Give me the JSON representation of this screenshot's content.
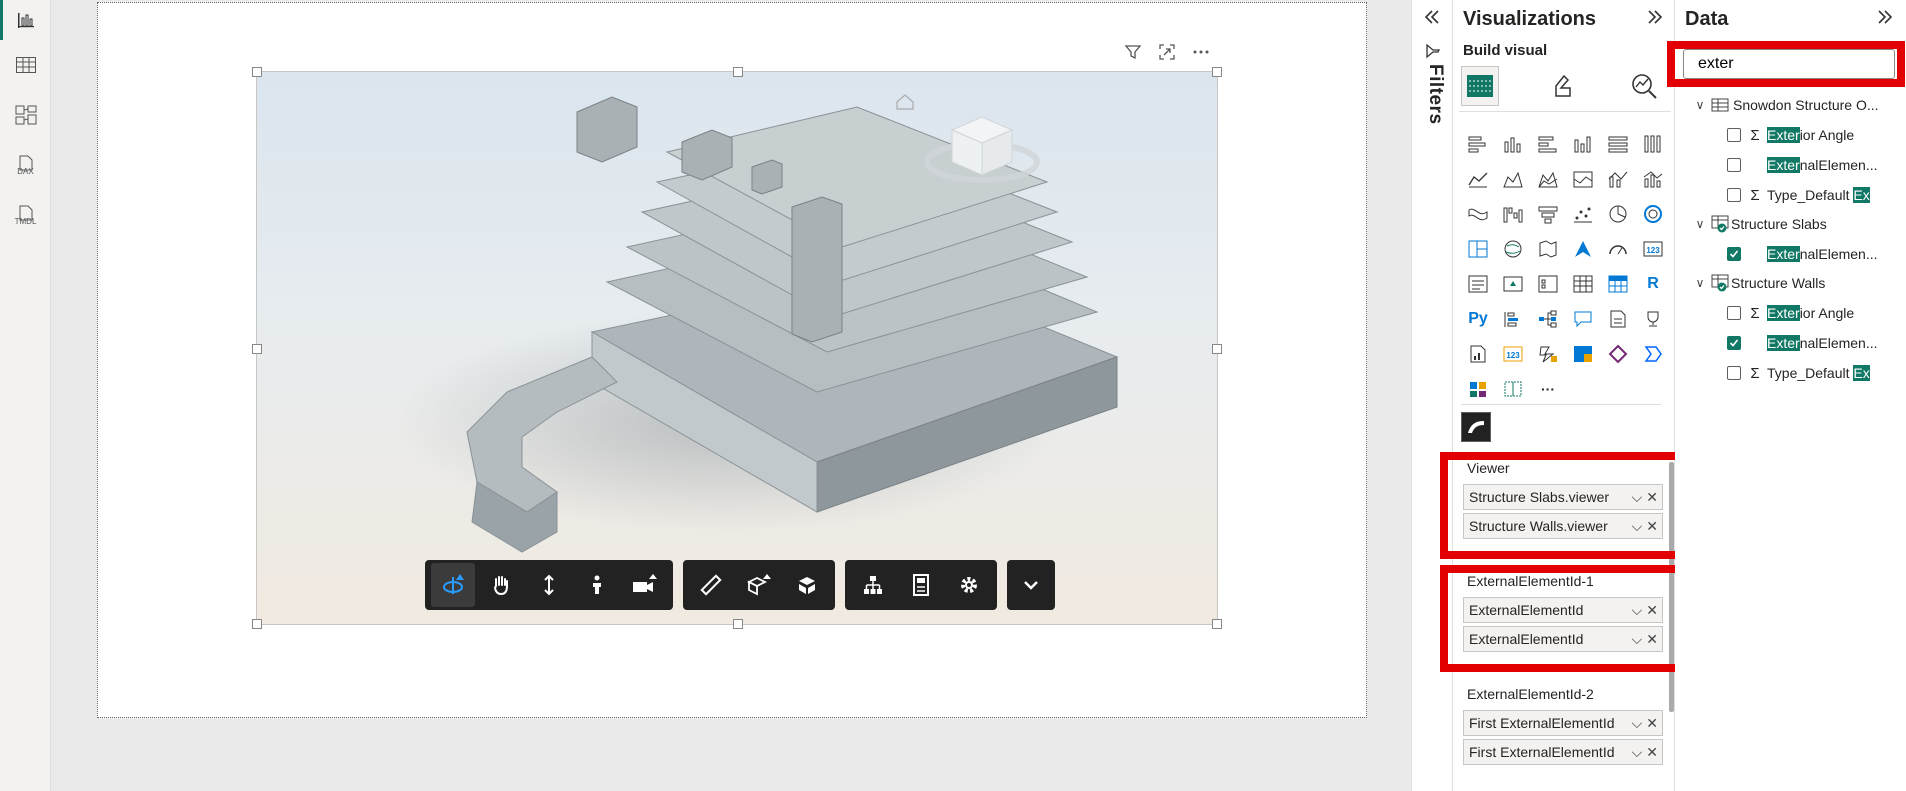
{
  "left_rail": {
    "items": [
      {
        "name": "report-view",
        "label": ""
      },
      {
        "name": "table-view",
        "label": ""
      },
      {
        "name": "model-view",
        "label": ""
      },
      {
        "name": "dax-query-view",
        "label": "DAX"
      },
      {
        "name": "tmdl-view",
        "label": "TMDL"
      }
    ]
  },
  "visual": {
    "toolbar_groups": [
      [
        "orbit-icon",
        "pan-icon",
        "zoom-icon",
        "first-person-icon",
        "camera-icon"
      ],
      [
        "measure-icon",
        "section-icon",
        "explode-icon"
      ],
      [
        "model-browser-icon",
        "properties-icon",
        "settings-icon"
      ],
      [
        "chevron-down-icon"
      ]
    ]
  },
  "filters": {
    "label": "Filters"
  },
  "visualizations": {
    "title": "Visualizations",
    "build_visual": "Build visual",
    "python_label": "Py",
    "r_label": "R",
    "card_label": "123",
    "more_label": "···",
    "wells": [
      {
        "label": "Viewer",
        "fields": [
          "Structure Slabs.viewer",
          "Structure Walls.viewer"
        ]
      },
      {
        "label": "ExternalElementId-1",
        "fields": [
          "ExternalElementId",
          "ExternalElementId"
        ]
      },
      {
        "label": "ExternalElementId-2",
        "fields": [
          "First ExternalElementId",
          "First ExternalElementId"
        ]
      }
    ]
  },
  "data": {
    "title": "Data",
    "search_value": "exter",
    "tables": [
      {
        "name": "Snowdon Structure O...",
        "fields": [
          {
            "pre": "",
            "hl": "Exter",
            "post": "ior Angle",
            "sigma": true,
            "checked": false
          },
          {
            "pre": "",
            "hl": "Exter",
            "post": "nalElemen...",
            "sigma": false,
            "checked": false
          },
          {
            "pre": "Type_Default ",
            "hl": "Ex",
            "post": "",
            "sigma": true,
            "checked": false
          }
        ]
      },
      {
        "name": "Structure Slabs",
        "fields": [
          {
            "pre": "",
            "hl": "Exter",
            "post": "nalElemen...",
            "sigma": false,
            "checked": true
          }
        ]
      },
      {
        "name": "Structure Walls",
        "fields": [
          {
            "pre": "",
            "hl": "Exter",
            "post": "ior Angle",
            "sigma": true,
            "checked": false
          },
          {
            "pre": "",
            "hl": "Exter",
            "post": "nalElemen...",
            "sigma": false,
            "checked": true
          },
          {
            "pre": "Type_Default ",
            "hl": "Ex",
            "post": "",
            "sigma": true,
            "checked": false
          }
        ]
      }
    ]
  },
  "colors": {
    "accent": "#117865",
    "highlight_box": "#e30000",
    "toolbar": "#222222",
    "active_tool": "#1e90ff"
  }
}
